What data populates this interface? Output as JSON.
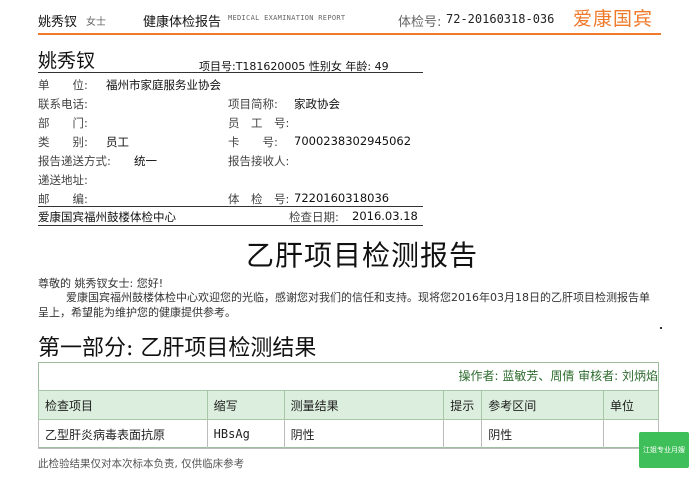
{
  "header": {
    "name": "姚秀钗",
    "gender": "女士",
    "title": "健康体检报告",
    "title_en": "MEDICAL EXAMINATION REPORT",
    "exam_no_label": "体检号:",
    "exam_no": "72-20160318-036",
    "logo": "爱康国宾",
    "accent_color": "#f07a2a"
  },
  "info": {
    "name": "姚秀钗",
    "item_meta": "项目号:T181620005  性别女  年龄: 49",
    "rows": [
      {
        "label": "单　　位:",
        "value": "福州市家庭服务业协会"
      },
      {
        "label": "联系电话:",
        "value": "",
        "label2": "项目简称:",
        "value2": "家政协会"
      },
      {
        "label": "部　　门:",
        "value": "",
        "label2": "员　工　号:",
        "value2": ""
      },
      {
        "label": "类　　别:",
        "value": "员工",
        "label2": "卡　　号:",
        "value2": "7000238302945062"
      },
      {
        "label": "报告递送方式:",
        "value": "统一",
        "label2": "报告接收人:",
        "value2": ""
      },
      {
        "label": "递送地址:",
        "value": ""
      },
      {
        "label": "邮　　编:",
        "value": "",
        "label2": "体　检　号:",
        "value2": "7220160318036"
      }
    ],
    "institution": "爱康国宾福州鼓楼体检中心",
    "date_label": "检查日期:",
    "date": "2016.03.18"
  },
  "report": {
    "title": "乙肝项目检测报告",
    "greeting": "尊敬的 姚秀钗女士: 您好!",
    "intro": "爱康国宾福州鼓楼体检中心欢迎您的光临，感谢您对我们的信任和支持。现将您2016年03月18日的乙肝项目检测报告单呈上，希望能为维护您的健康提供参考。",
    "section_title": "第一部分: 乙肝项目检测结果",
    "operators": "操作者: 蓝敏芳、周倩   审核者: 刘炳焰",
    "table": {
      "headers": [
        "检查项目",
        "缩写",
        "测量结果",
        "提示",
        "参考区间",
        "单位"
      ],
      "rows": [
        [
          "乙型肝炎病毒表面抗原",
          "HBsAg",
          "阴性",
          "",
          "阴性",
          ""
        ]
      ]
    },
    "disclaimer": "此检验结果仅对本次标本负责, 仅供临床参考",
    "badge": "江姐专业月嫂",
    "badge_color": "#3fbf5a"
  }
}
